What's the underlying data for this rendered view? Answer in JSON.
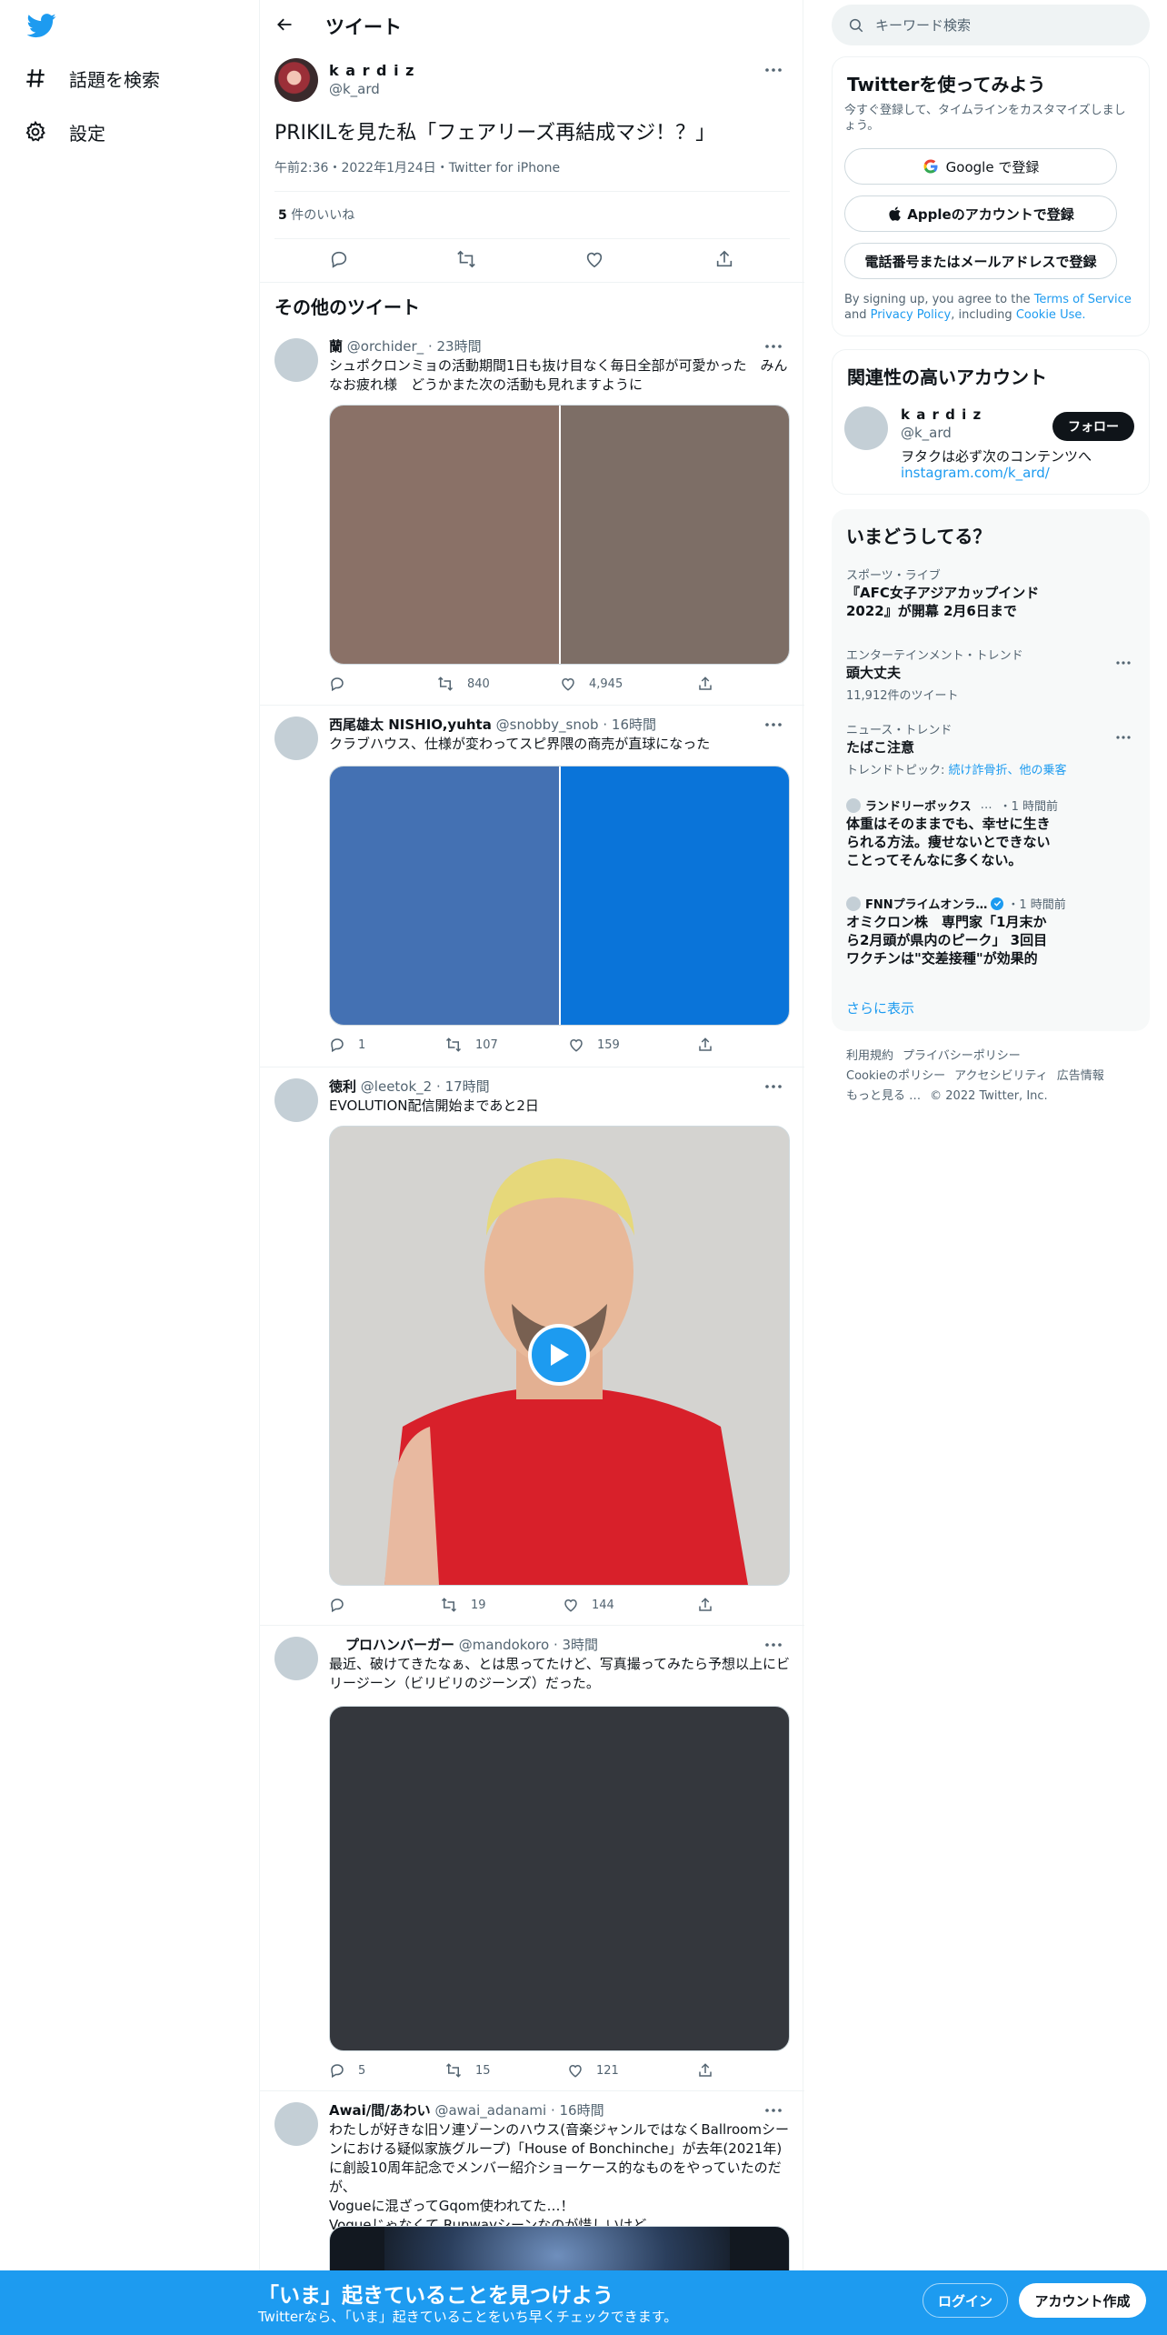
{
  "nav": {
    "explore_label": "話題を検索",
    "settings_label": "設定"
  },
  "header": {
    "title": "ツイート"
  },
  "main_tweet": {
    "display_name": "k a r d i z",
    "handle": "@k_ard",
    "text": "PRIKILを見た私「フェアリーズ再結成マジ！？」",
    "timestamp": "午前2:36・2022年1月24日・Twitter for iPhone",
    "likes_count": "5",
    "likes_label": " 件のいいね"
  },
  "more_tweets_title": "その他のツイート",
  "tweets": [
    {
      "name": "蘭",
      "handle": "@orchider_",
      "time": "23時間",
      "text": "シュポクロンミョの活動期間1日も抜け目なく毎日全部が可愛かった　みんなお疲れ様　どうかまた次の活動も見れますように",
      "reply": "",
      "retweet": "840",
      "like": "4,945",
      "media_colors": [
        "#8a7167",
        "#7d6e66"
      ]
    },
    {
      "name": "西尾雄太 NISHIO,yuhta",
      "handle": "@snobby_snob",
      "time": "16時間",
      "text": "クラブハウス、仕様が変わってスピ界隈の商売が直球になった",
      "reply": "1",
      "retweet": "107",
      "like": "159",
      "media_colors": [
        "#4471b3",
        "#0a74d9"
      ]
    },
    {
      "name": "徳利",
      "handle": "@leetok_2",
      "time": "17時間",
      "text": "EVOLUTION配信開始まであと2日",
      "reply": "",
      "retweet": "19",
      "like": "144"
    },
    {
      "name": "プロハンバーガー",
      "handle": "@mandokoro",
      "time": "3時間",
      "text": "最近、破けてきたなぁ、とは思ってたけど、写真撮ってみたら予想以上にビリージーン（ビリビリのジーンズ）だった。",
      "reply": "5",
      "retweet": "15",
      "like": "121"
    },
    {
      "name": "Awai/間/あわい",
      "handle": "@awai_adanami",
      "time": "16時間",
      "text_lines": [
        "わたしが好きな旧ソ連ゾーンのハウス(音楽ジャンルではなくBallroomシーンにおける疑似家族グループ)「House of Bonchinche」が去年(2021年)に創設10周年記念でメンバー紹介ショーケース的なものをやっていたのだが、",
        "Vogueに混ざってGqom使われてた…！",
        "Vogueじゃなくて Runwayシーンなのが惜しいけど…"
      ]
    }
  ],
  "search": {
    "placeholder": "キーワード検索"
  },
  "signup_panel": {
    "title": "Twitterを使ってみよう",
    "subtitle": "今すぐ登録して、タイムラインをカスタマイズしましょう。",
    "google_label": "Google で登録",
    "apple_label": "Appleのアカウントで登録",
    "phone_label": "電話番号またはメールアドレスで登録",
    "terms_prefix": "By signing up, you agree to the ",
    "terms_link": "Terms of Service",
    "terms_and": " and ",
    "privacy_link": "Privacy Policy",
    "terms_including": ", including ",
    "cookie_link": "Cookie Use."
  },
  "related_panel": {
    "title": "関連性の高いアカウント",
    "name": "k a r d i z",
    "handle": "@k_ard",
    "follow_label": "フォロー",
    "bio": "ヲタクは必ず次のコンテンツへ",
    "bio_link": "instagram.com/k_ard/"
  },
  "trends_panel": {
    "title": "いまどうしてる？",
    "items": [
      {
        "meta": "スポーツ・ライブ",
        "title": "『AFC女子アジアカップインド2022』が開幕 2月6日まで"
      },
      {
        "meta": "エンターテインメント・トレンド",
        "title": "頭大丈夫",
        "sub": "11,912件のツイート"
      },
      {
        "meta": "ニュース・トレンド",
        "title": "たばこ注意",
        "sub_prefix": "トレンドトピック: ",
        "sub_links": "続け詐骨折、他の乗客"
      },
      {
        "source": "ランドリーボックス",
        "time": "・1 時間前",
        "title": "体重はそのままでも、幸せに生きられる方法。痩せないとできないことってそんなに多くない。"
      },
      {
        "source": "FNNプライムオンラ…",
        "time": "・1 時間前",
        "title": "オミクロン株　専門家「1月末から2月頭が県内のピーク」 3回目ワクチンは\"交差接種\"が効果的"
      }
    ],
    "show_more": "さらに表示"
  },
  "footer": {
    "links_row1": [
      "利用規約",
      "プライバシーポリシー"
    ],
    "links_row2": [
      "Cookieのポリシー",
      "アクセシビリティ",
      "広告情報"
    ],
    "more": "もっと見る …",
    "copyright": "© 2022 Twitter, Inc."
  },
  "bottom_bar": {
    "title": "「いま」起きていることを見つけよう",
    "subtitle": "Twitterなら、「いま」起きていることをいち早くチェックできます。",
    "login_label": "ログイン",
    "signup_label": "アカウント作成"
  },
  "colors": {
    "accent": "#1d9bf0",
    "text": "#0f1419",
    "muted": "#536471"
  }
}
